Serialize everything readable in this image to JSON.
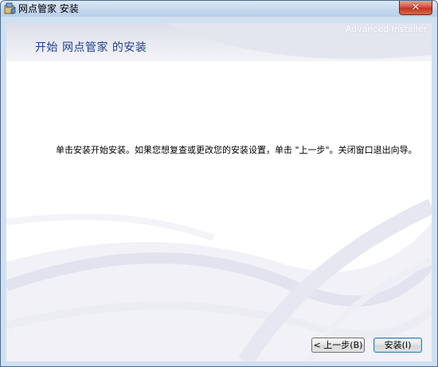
{
  "window": {
    "title": "网点管家 安装",
    "close_label": "✕"
  },
  "brand": "Advanced Installer",
  "heading": "开始 网点管家 的安装",
  "message": "单击安装开始安装。如果您想复查或更改您的安装设置，单击 \"上一步\"。关闭窗口退出向导。",
  "buttons": {
    "back": "< 上一步(B)",
    "install": "安装(I)"
  }
}
